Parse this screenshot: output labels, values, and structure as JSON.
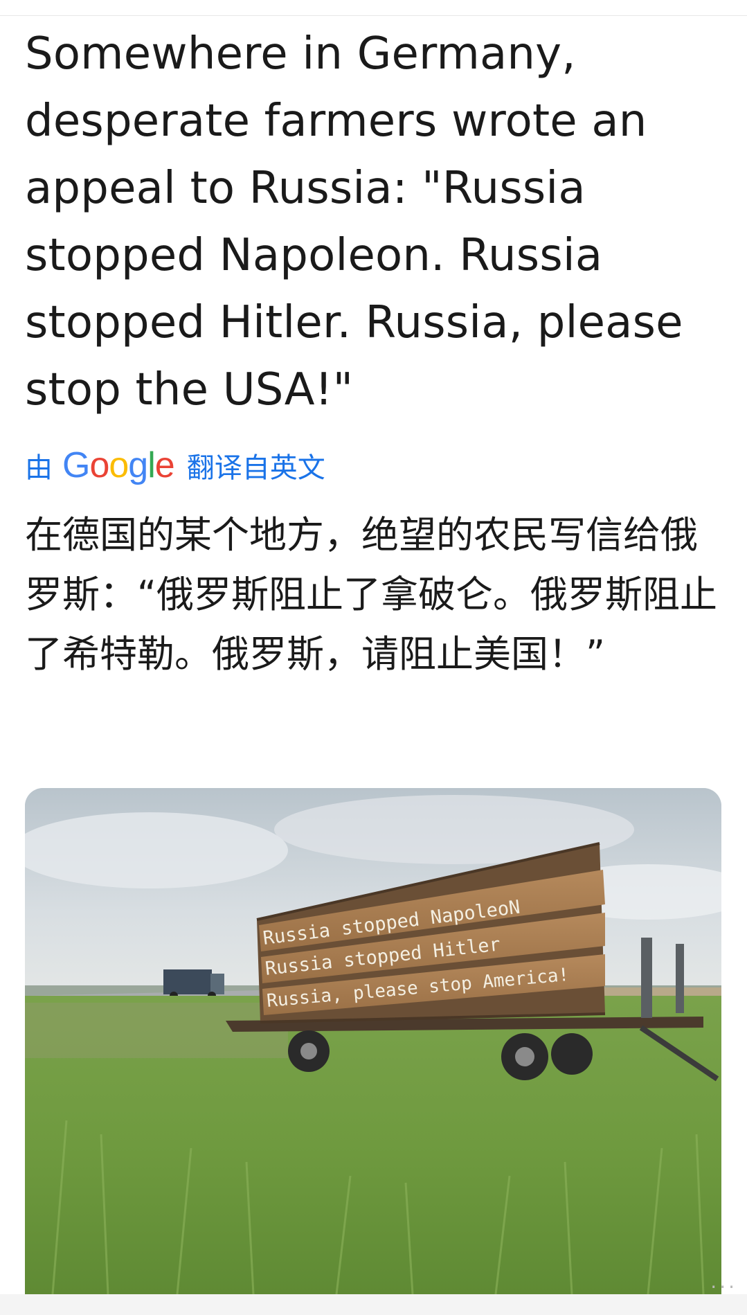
{
  "post": {
    "original_text": "Somewhere in Germany, desperate farmers wrote an appeal to Russia: \"Russia stopped Napoleon. Russia stopped Hitler. Russia, please stop the USA!\"",
    "translate_prefix": "由",
    "translate_brand": "Google",
    "translate_suffix": "翻译自英文",
    "translated_text": "在德国的某个地方，绝望的农民写信给俄罗斯：“俄罗斯阻止了拿破仑。俄罗斯阻止了希特勒。俄罗斯，请阻止美国！”"
  },
  "photo": {
    "sign_line_1": "Russia stopped NapoleoN",
    "sign_line_2": "Russia stopped Hitler",
    "sign_line_3": "Russia, please stop America!"
  },
  "colors": {
    "link_blue": "#1a73e8",
    "google_blue": "#4285F4",
    "google_red": "#EA4335",
    "google_yellow": "#FBBC05",
    "google_green": "#34A853"
  },
  "icons": {
    "more": "ellipsis-icon"
  }
}
